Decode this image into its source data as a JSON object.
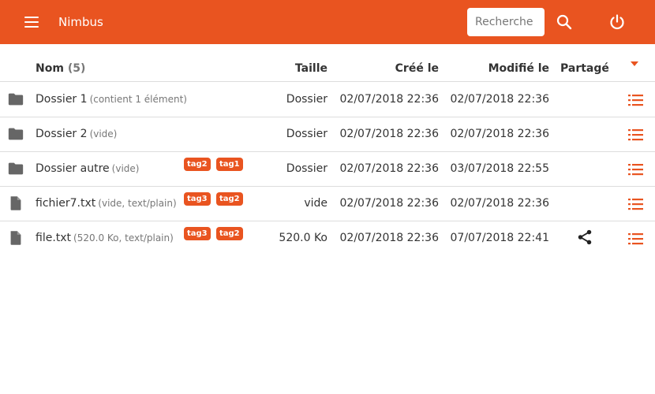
{
  "topbar": {
    "menu_icon": "hamburger-menu-icon",
    "title": "Nimbus",
    "search_placeholder": "Recherche",
    "search_icon": "search-icon",
    "logout_icon": "power-icon",
    "color": "#e95420"
  },
  "table": {
    "headers": {
      "name": "Nom",
      "count": "(5)",
      "size": "Taille",
      "created": "Créé le",
      "modified": "Modifié le",
      "shared": "Partagé"
    },
    "rows": [
      {
        "type": "folder",
        "icon": "folder-icon",
        "name": "Dossier 1",
        "desc": "(contient 1 élément)",
        "tags": [],
        "size": "Dossier",
        "created": "02/07/2018 22:36",
        "modified": "02/07/2018 22:36",
        "shared": false
      },
      {
        "type": "folder",
        "icon": "folder-icon",
        "name": "Dossier 2",
        "desc": "(vide)",
        "tags": [],
        "size": "Dossier",
        "created": "02/07/2018 22:36",
        "modified": "02/07/2018 22:36",
        "shared": false
      },
      {
        "type": "folder",
        "icon": "folder-icon",
        "name": "Dossier autre",
        "desc": "(vide)",
        "tags": [
          "tag2",
          "tag1"
        ],
        "size": "Dossier",
        "created": "02/07/2018 22:36",
        "modified": "03/07/2018 22:55",
        "shared": false
      },
      {
        "type": "file",
        "icon": "file-icon",
        "name": "fichier7.txt",
        "desc": "(vide, text/plain)",
        "tags": [
          "tag3",
          "tag2"
        ],
        "size": "vide",
        "created": "02/07/2018 22:36",
        "modified": "02/07/2018 22:36",
        "shared": false
      },
      {
        "type": "file",
        "icon": "file-icon",
        "name": "file.txt",
        "desc": "(520.0 Ko, text/plain)",
        "tags": [
          "tag3",
          "tag2"
        ],
        "size": "520.0 Ko",
        "created": "02/07/2018 22:36",
        "modified": "07/07/2018 22:41",
        "shared": true
      }
    ]
  }
}
